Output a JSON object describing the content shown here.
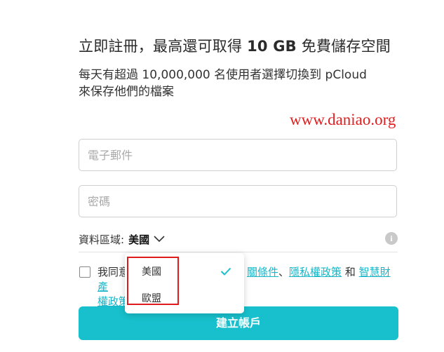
{
  "header": {
    "headline_prefix": "立即註冊，最高還可取得 ",
    "headline_bold": "10 GB",
    "headline_suffix": " 免費儲存空間",
    "subtitle_line1": "每天有超過 10,000,000 名使用者選擇切換到 pCloud",
    "subtitle_line2": "來保存他們的檔案"
  },
  "watermark": "www.daniao.org",
  "form": {
    "email_placeholder": "電子郵件",
    "email_value": "",
    "password_placeholder": "密碼",
    "password_value": "",
    "region_label": "資料區域:",
    "region_value": "美國",
    "region_icon": "chevron-down-icon",
    "info_icon": "info-icon",
    "terms_prefix": "我同意",
    "terms_link1_partial": "關條件",
    "terms_separator": "、",
    "terms_link2": "隱私權政策",
    "terms_and": " 和 ",
    "terms_link3": "智慧財產",
    "terms_line2": "權政策",
    "submit_label": "建立帳戶"
  },
  "dropdown": {
    "options": [
      "美國",
      "歐盟"
    ],
    "selected": "美國"
  },
  "colors": {
    "accent": "#17c0cc",
    "link": "#17b6c8",
    "watermark": "#e02020",
    "highlight_box": "#e01b1b"
  }
}
